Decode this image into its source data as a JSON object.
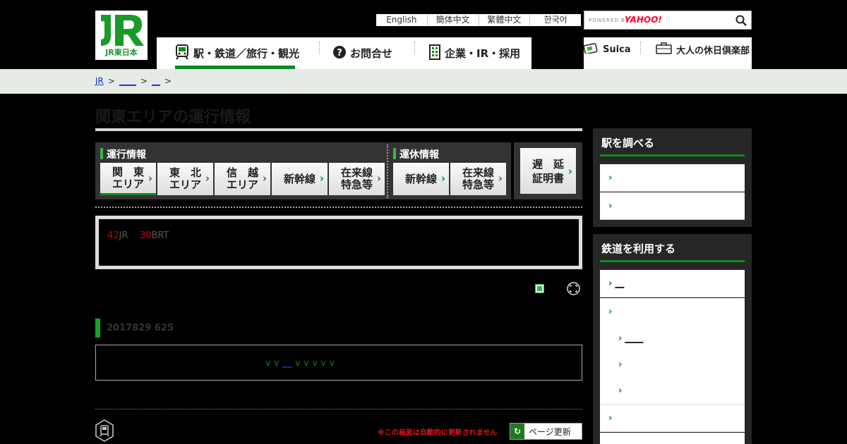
{
  "header": {
    "logo_text": "JR東日本",
    "lang_links": [
      "English",
      "簡体中文",
      "繁體中文",
      "한국어"
    ],
    "search": {
      "powered_by": "POWERED BY",
      "provider": "YAHOO!",
      "placeholder": ""
    },
    "nav_main": [
      {
        "label": "駅・鉄道／旅行・観光"
      },
      {
        "label": "お問合せ"
      },
      {
        "label": "企業・IR・採用"
      }
    ],
    "nav_sub": [
      {
        "label": "Suica"
      },
      {
        "label": "大人の休日倶楽部"
      }
    ]
  },
  "breadcrumb": {
    "root": "JR",
    "sep": ">",
    "item1": "____",
    "item2": "__"
  },
  "main": {
    "title": "関東エリアの運行情報",
    "operation": {
      "heading": "運行情報",
      "areas": [
        {
          "line1": "関　東",
          "line2": "エリア"
        },
        {
          "line1": "東　北",
          "line2": "エリア"
        },
        {
          "line1": "信　越",
          "line2": "エリア"
        },
        {
          "line1": "新幹線",
          "line2": ""
        },
        {
          "line1": "在来線",
          "line2": "特急等"
        }
      ]
    },
    "suspension": {
      "heading": "運休情報",
      "items": [
        {
          "line1": "新幹線",
          "line2": ""
        },
        {
          "line1": "在来線",
          "line2": "特急等"
        }
      ]
    },
    "delay_cert": {
      "line1": "遅　延",
      "line2": "証明書"
    },
    "summary": {
      "num1": "42",
      "text1": "JR",
      "num2": "30",
      "text2": "BRT"
    },
    "update_heading": "2017829 625",
    "line_links": {
      "a": "v",
      "b": "v",
      "c": "__",
      "d": "v",
      "e": "v",
      "f": "v",
      "g": "v",
      "h": "v"
    },
    "auto_refresh_note": "※この画面は自動的に更新されません",
    "refresh_label": "ページ更新"
  },
  "sidebar": {
    "stations": {
      "title": "駅を調べる",
      "items": [
        "",
        ""
      ]
    },
    "railway": {
      "title": "鉄道を利用する",
      "items": [
        "__",
        "",
        "____",
        "",
        "",
        "",
        ""
      ]
    }
  },
  "colors": {
    "brand_green": "#0f8a1e",
    "alert_red": "#e8121a"
  }
}
